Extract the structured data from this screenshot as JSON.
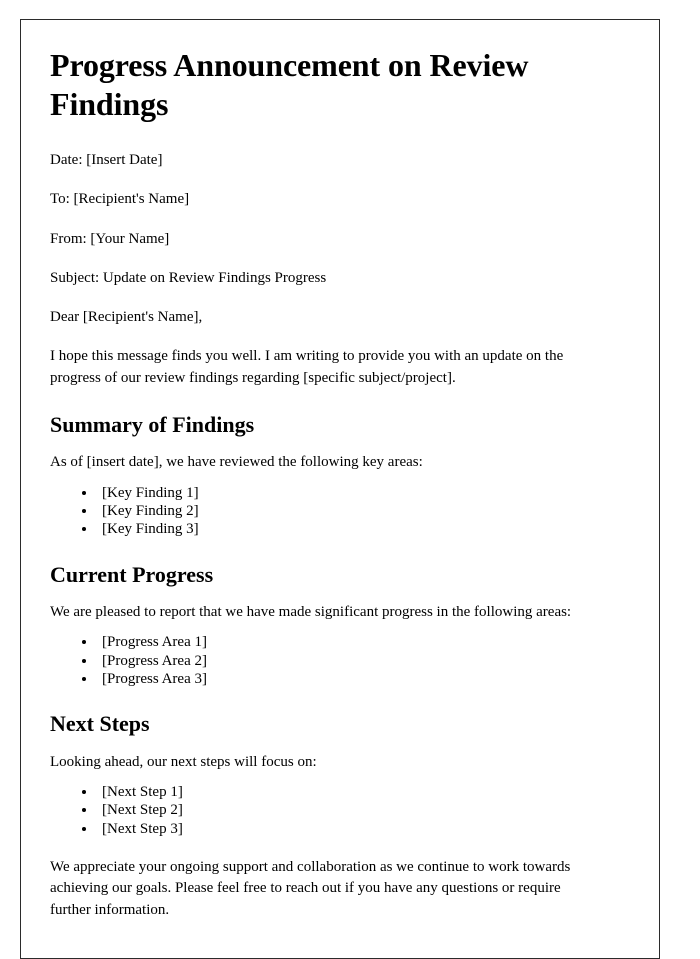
{
  "document": {
    "title": "Progress Announcement on Review Findings",
    "meta": [
      {
        "key": "date",
        "text": "Date: [Insert Date]"
      },
      {
        "key": "to",
        "text": "To: [Recipient's Name]"
      },
      {
        "key": "from",
        "text": "From: [Your Name]"
      },
      {
        "key": "subject",
        "text": "Subject: Update on Review Findings Progress"
      }
    ],
    "salutation": "Dear [Recipient's Name],",
    "intro_paragraph": "I hope this message finds you well. I am writing to provide you with an update on the progress of our review findings regarding [specific subject/project].",
    "sections": [
      {
        "heading": "Summary of Findings",
        "lead": "As of [insert date], we have reviewed the following key areas:",
        "items": [
          "[Key Finding 1]",
          "[Key Finding 2]",
          "[Key Finding 3]"
        ]
      },
      {
        "heading": "Current Progress",
        "lead": "We are pleased to report that we have made significant progress in the following areas:",
        "items": [
          "[Progress Area 1]",
          "[Progress Area 2]",
          "[Progress Area 3]"
        ]
      },
      {
        "heading": "Next Steps",
        "lead": "Looking ahead, our next steps will focus on:",
        "items": [
          "[Next Step 1]",
          "[Next Step 2]",
          "[Next Step 3]"
        ]
      }
    ],
    "closing_paragraph": "We appreciate your ongoing support and collaboration as we continue to work towards achieving our goals. Please feel free to reach out if you have any questions or require further information."
  }
}
